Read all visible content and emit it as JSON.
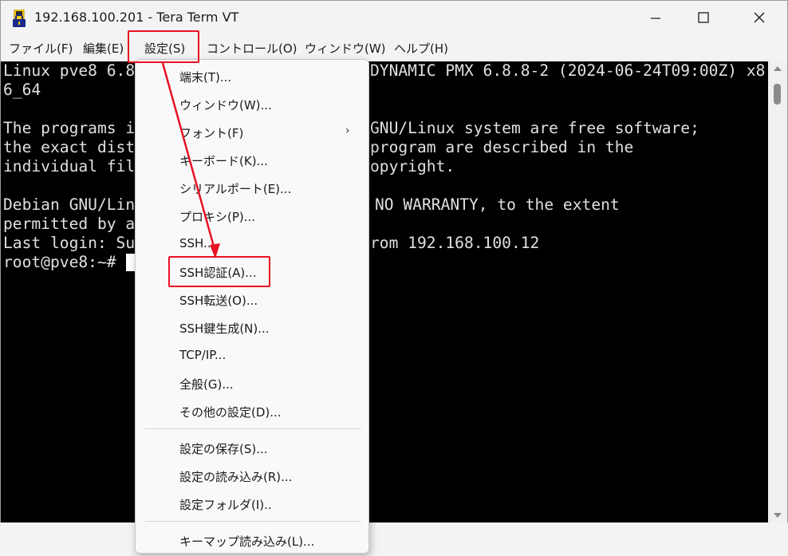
{
  "window": {
    "title": "192.168.100.201 - Tera Term VT",
    "icon": "tera-term-lock-icon",
    "buttons": [
      "minimize-icon",
      "maximize-icon",
      "close-icon"
    ]
  },
  "menubar": {
    "items": [
      {
        "label": "ファイル(F)"
      },
      {
        "label": "編集(E)"
      },
      {
        "label": "設定(S)"
      },
      {
        "label": "コントロール(O)"
      },
      {
        "label": "ウィンドウ(W)"
      },
      {
        "label": "ヘルプ(H)"
      }
    ]
  },
  "terminal": {
    "lines": [
      "Linux pve8 6.8",
      "6_64",
      "",
      "The programs i",
      "the exact dist",
      "individual fil",
      "",
      "Debian GNU/Lin",
      "permitted by a",
      "Last login: Su",
      "root@pve8:~#"
    ],
    "right_fragments": [
      "DYNAMIC PMX 6.8.8-2 (2024-06-24T09:00Z) x8",
      "GNU/Linux system are free software;",
      "program are described in the",
      "opyright.",
      "NO WARRANTY, to the extent",
      "rom 192.168.100.12"
    ]
  },
  "dropdown": {
    "items": [
      {
        "label": "端末(T)..."
      },
      {
        "label": "ウィンドウ(W)..."
      },
      {
        "label": "フォント(F)",
        "submenu_arrow": "›"
      },
      {
        "label": "キーボード(K)..."
      },
      {
        "label": "シリアルポート(E)..."
      },
      {
        "label": "プロキシ(P)..."
      },
      {
        "label": "SSH..."
      },
      {
        "label": "SSH認証(A)..."
      },
      {
        "label": "SSH転送(O)..."
      },
      {
        "label": "SSH鍵生成(N)..."
      },
      {
        "label": "TCP/IP..."
      },
      {
        "label": "全般(G)..."
      },
      {
        "label": "その他の設定(D)..."
      },
      {
        "label": "設定の保存(S)..."
      },
      {
        "label": "設定の読み込み(R)..."
      },
      {
        "label": "設定フォルダ(I).."
      },
      {
        "label": "キーマップ読み込み(L)..."
      }
    ]
  },
  "colors": {
    "highlight": "#e81123",
    "terminal_bg": "#000000",
    "terminal_fg": "#e0e0e0"
  }
}
